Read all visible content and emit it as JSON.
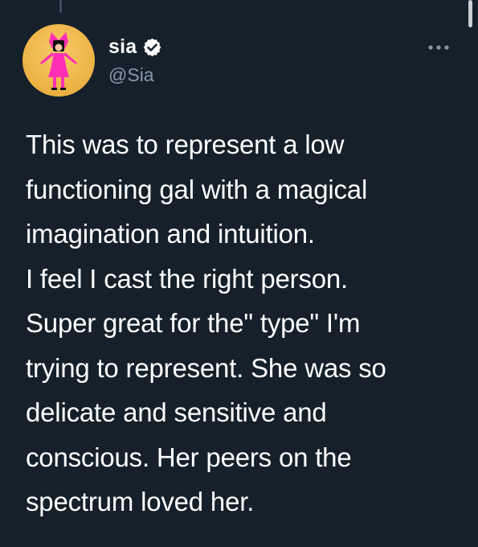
{
  "tweet": {
    "author": {
      "display_name": "sia",
      "handle": "@Sia",
      "verified": true,
      "avatar_icon": "profile-avatar"
    },
    "more_icon": "more-horizontal-icon",
    "verified_icon": "verified-badge-icon",
    "text": "This was to represent a low\nfunctioning gal with a magical\nimagination and intuition.\nI feel I cast the right person.\nSuper great for the\" type\" I'm\ntrying to represent. She was so\ndelicate and sensitive and\nconscious. Her peers on the\nspectrum loved her."
  },
  "colors": {
    "background": "#15202b",
    "text_primary": "#ffffff",
    "text_secondary": "#8899a6",
    "verified_badge": "#ffffff",
    "avatar_background": "#eeb548",
    "avatar_figure": "#ff2fb3"
  }
}
